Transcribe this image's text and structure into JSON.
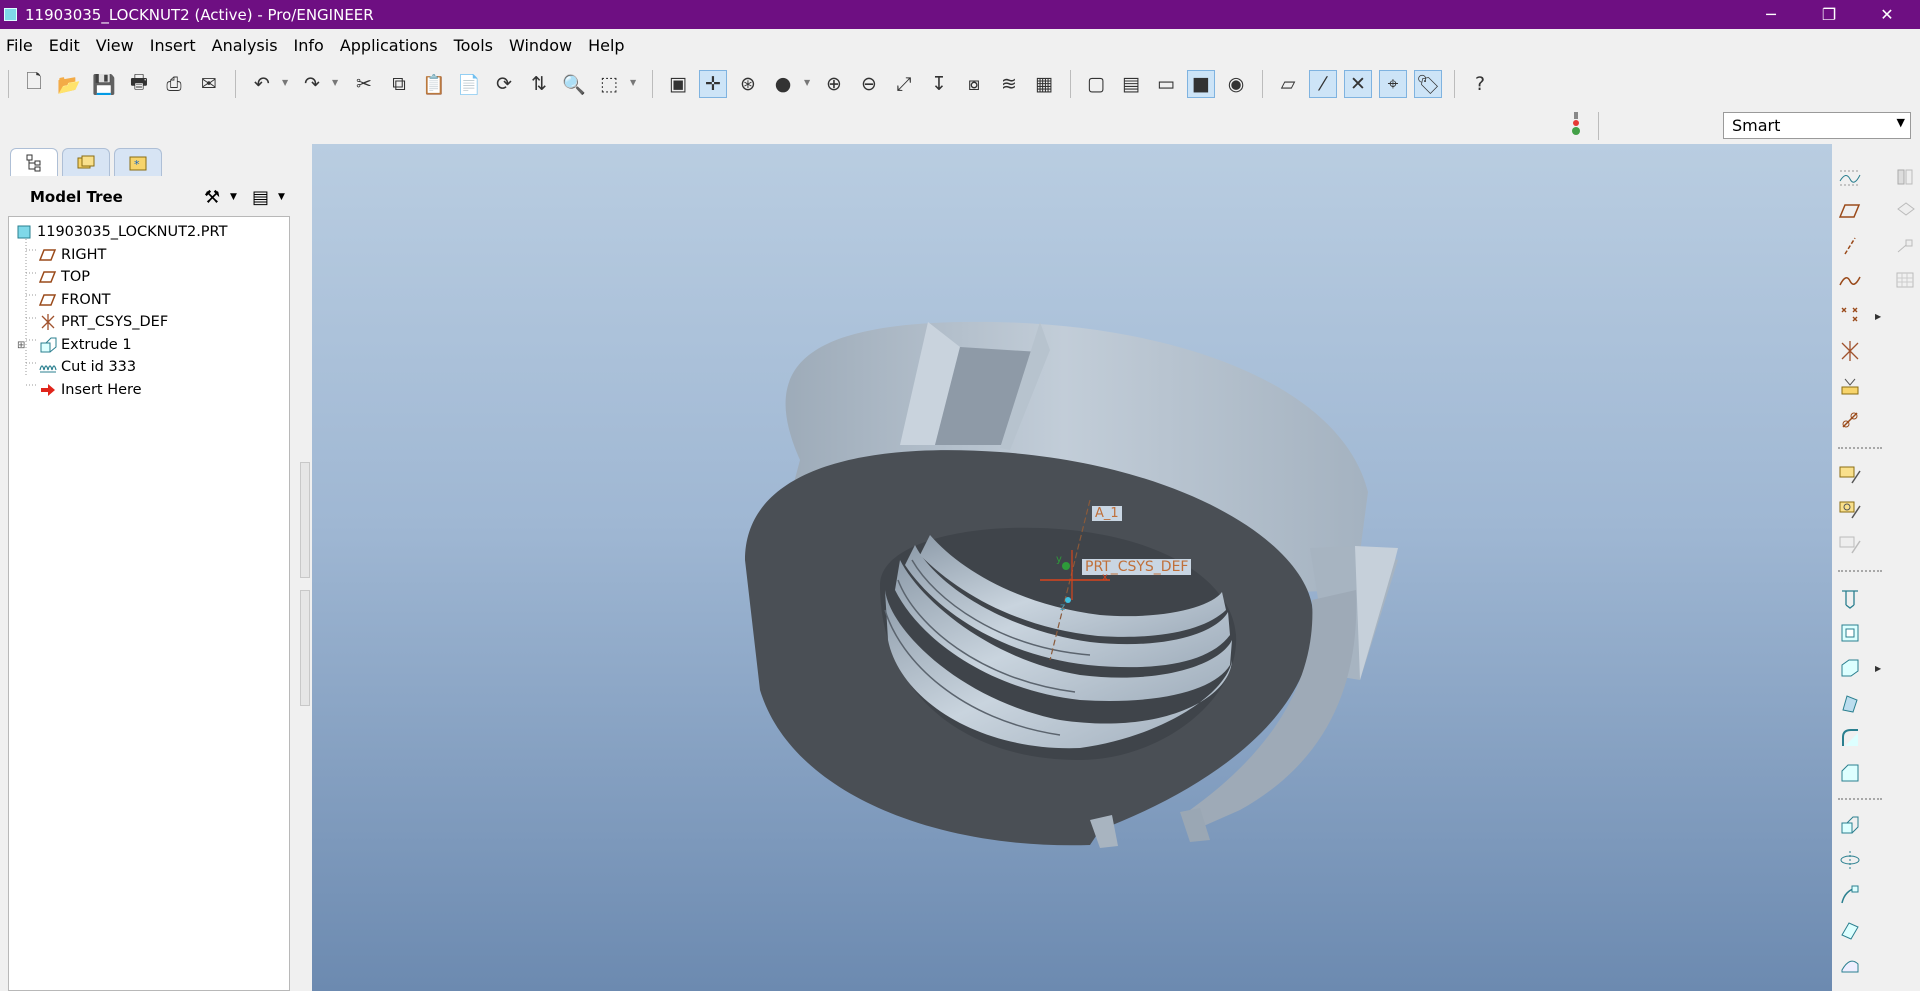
{
  "window": {
    "title": "11903035_LOCKNUT2 (Active) - Pro/ENGINEER",
    "controls": {
      "minimize": "─",
      "restore": "❐",
      "close": "✕"
    }
  },
  "menu": [
    "File",
    "Edit",
    "View",
    "Insert",
    "Analysis",
    "Info",
    "Applications",
    "Tools",
    "Window",
    "Help"
  ],
  "toolbar_icons": {
    "new": "🗋",
    "open": "📂",
    "save": "💾",
    "print": "🖶",
    "print_preview": "⎙",
    "email": "✉",
    "undo": "↶",
    "redo": "↷",
    "cut": "✂",
    "copy": "⧉",
    "paste": "📋",
    "paste_special": "📄",
    "regenerate": "⟳",
    "regen_manager": "⇅",
    "find": "🔍",
    "select_box": "⬚",
    "redraw": "▣",
    "spin_center": "✛",
    "orient": "⊛",
    "display_style": "●",
    "zoom_in": "⊕",
    "zoom_out": "⊖",
    "refit": "⤢",
    "reorient": "↧",
    "saved_views": "⧇",
    "layers": "≋",
    "view_manager": "▦",
    "wireframe": "▢",
    "hidden_line": "▤",
    "no_hidden": "▭",
    "shading": "■",
    "appearance": "◉",
    "datum_planes": "▱",
    "datum_axes": "⁄",
    "datum_points": "✕",
    "csys": "⌖",
    "annotations": "🏷",
    "context_help": "?"
  },
  "filter": {
    "value": "Smart",
    "status_icon": "traffic-light"
  },
  "model_tree": {
    "tabs": [
      "model-tree-tab",
      "layer-tab",
      "favorites-tab"
    ],
    "header": "Model Tree",
    "items": [
      {
        "label": "11903035_LOCKNUT2.PRT",
        "icon": "part-icon"
      },
      {
        "label": "RIGHT",
        "icon": "datum-plane-icon"
      },
      {
        "label": "TOP",
        "icon": "datum-plane-icon"
      },
      {
        "label": "FRONT",
        "icon": "datum-plane-icon"
      },
      {
        "label": "PRT_CSYS_DEF",
        "icon": "csys-icon"
      },
      {
        "label": "Extrude 1",
        "icon": "extrude-icon",
        "expandable": true
      },
      {
        "label": "Cut id 333",
        "icon": "cosmetic-thread-icon"
      },
      {
        "label": "Insert Here",
        "icon": "insert-arrow-icon"
      }
    ]
  },
  "viewport": {
    "axis_label": "A_1",
    "csys_label": "PRT_CSYS_DEF",
    "csys_axes": {
      "x": "x",
      "y": "y",
      "z": "z"
    },
    "colors": {
      "face": "#4a4f55",
      "side": "#aab6c2",
      "thread": "#b8c4cf",
      "bg_top": "#b9cde1",
      "bg_bottom": "#6c8ab0"
    }
  }
}
